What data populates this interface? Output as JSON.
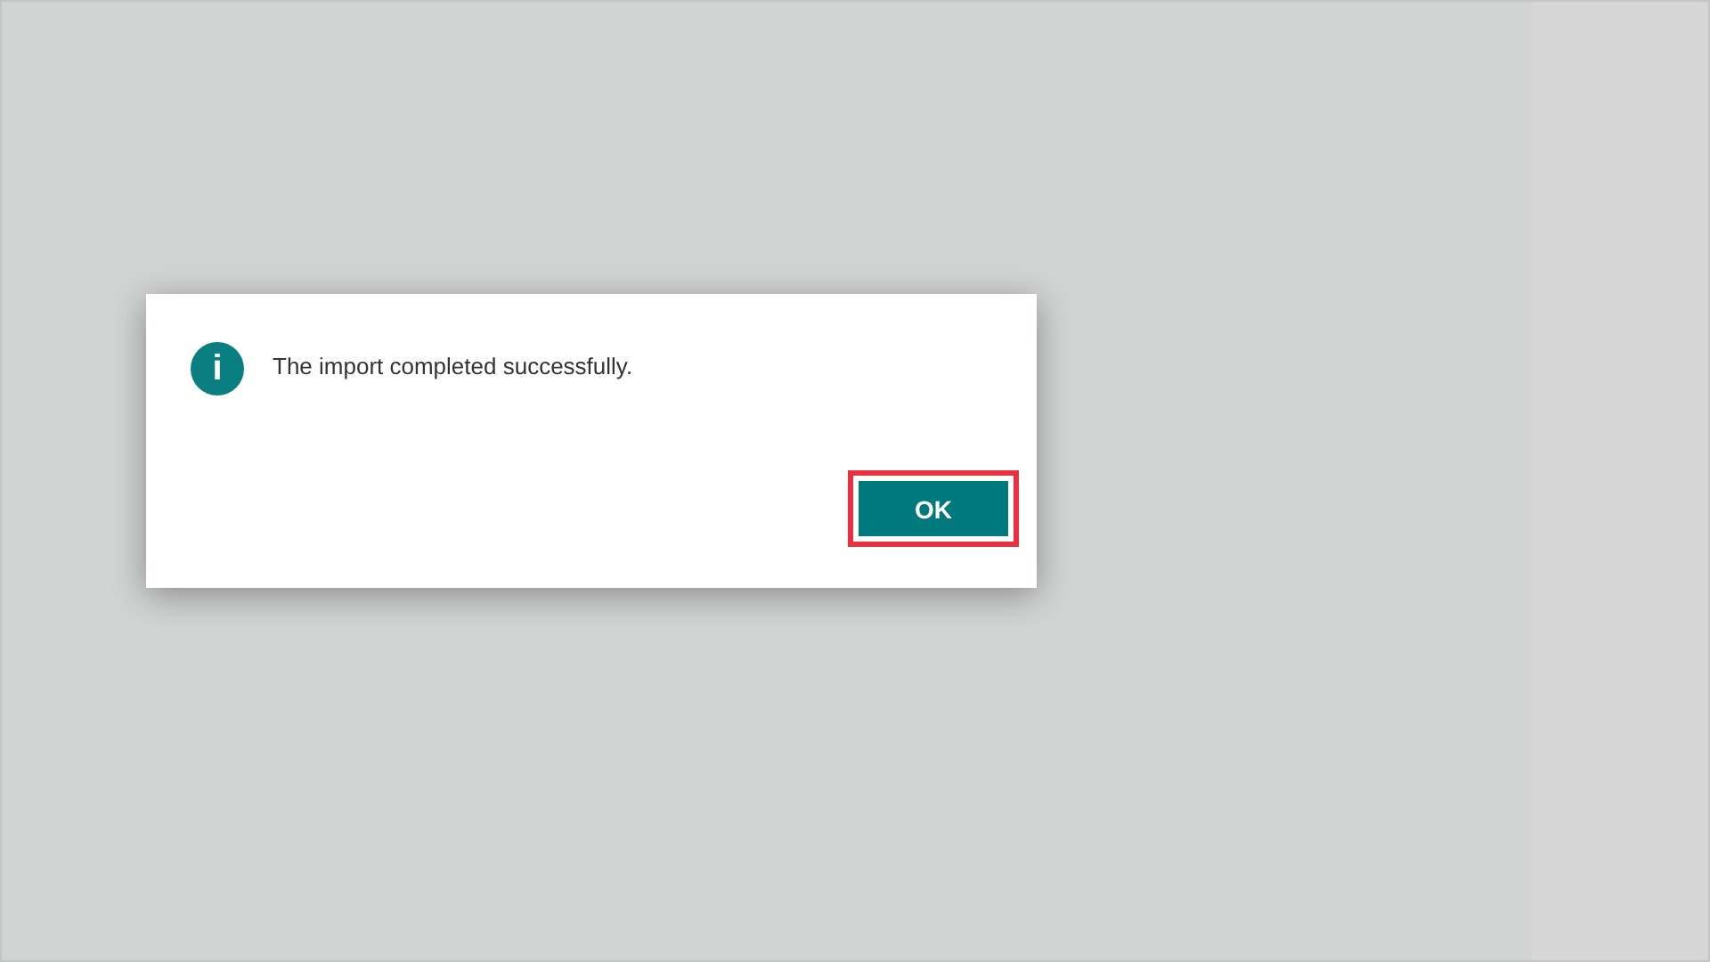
{
  "dialog": {
    "icon_glyph": "i",
    "message": "The import completed successfully.",
    "buttons": [
      {
        "label": "OK",
        "highlighted": true
      }
    ]
  }
}
